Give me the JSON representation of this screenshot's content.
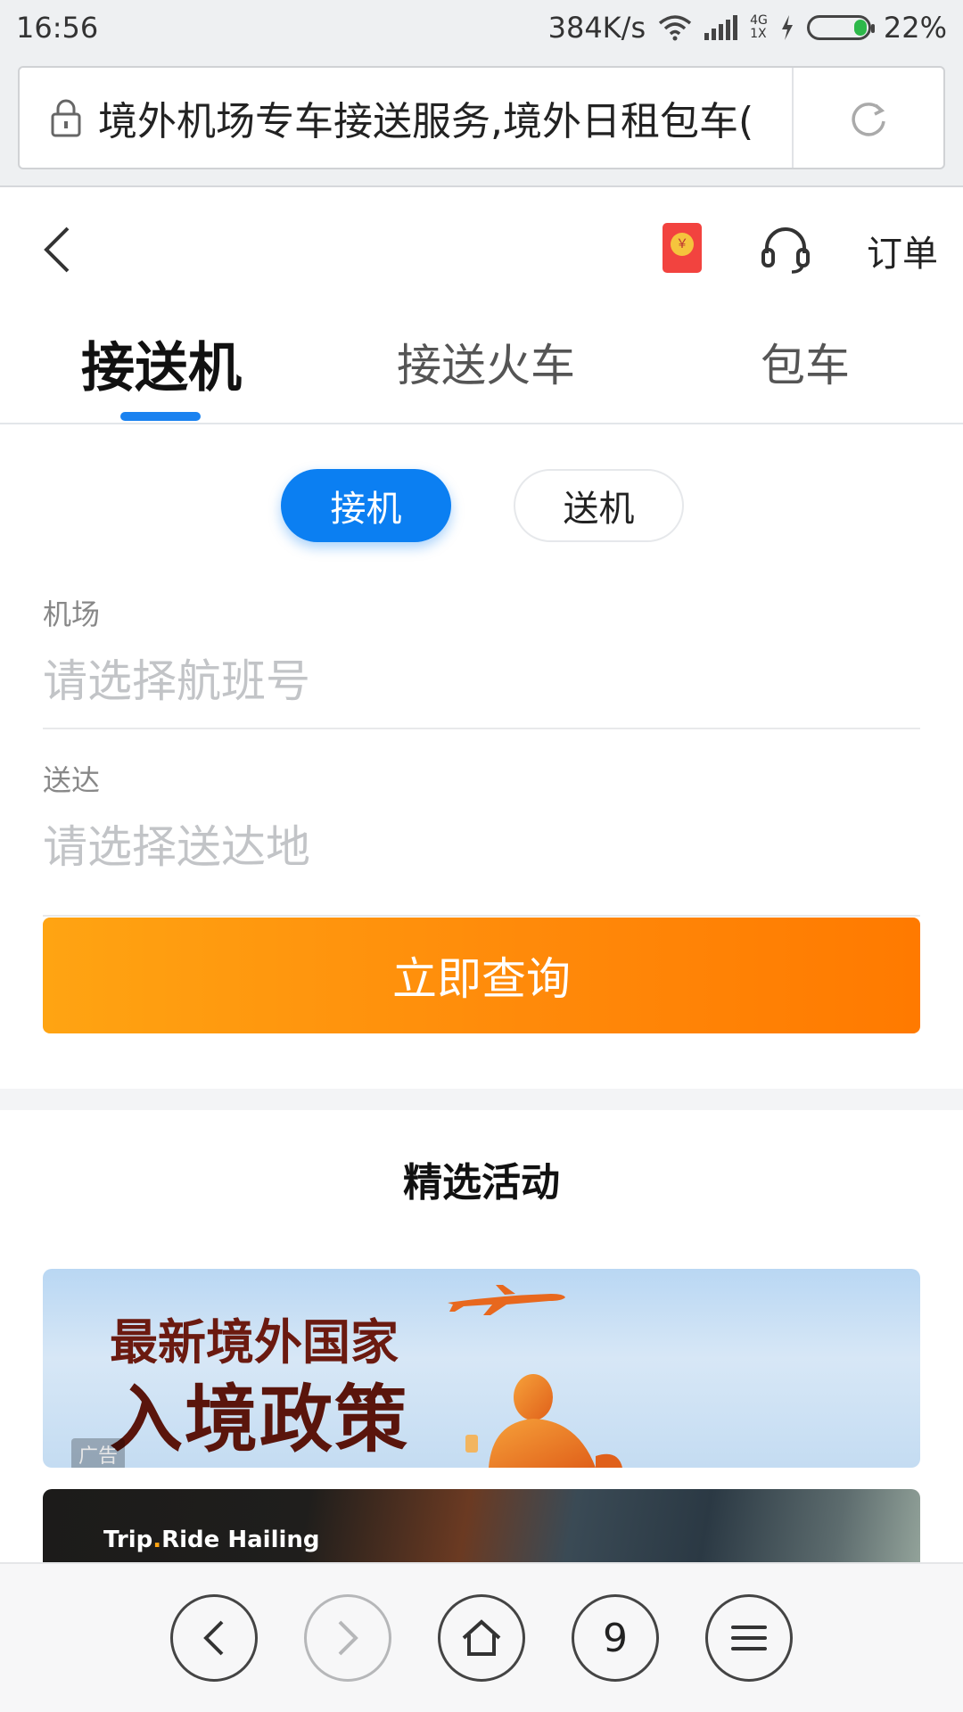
{
  "status_bar": {
    "time": "16:56",
    "net_speed": "384K/s",
    "net_type_top": "4G",
    "net_type_bottom": "1X",
    "battery": "22%",
    "battery_color": "#2db84a"
  },
  "browser": {
    "url_title": "境外机场专车接送服务,境外日租包车(",
    "lock_icon": "lock-icon",
    "reload_icon": "reload-icon"
  },
  "header": {
    "back_icon": "chevron-left-icon",
    "red_packet_icon": "red-packet-icon",
    "support_icon": "headset-icon",
    "orders_label": "订单"
  },
  "tabs": [
    {
      "label": "接送机",
      "active": true
    },
    {
      "label": "接送火车",
      "active": false
    },
    {
      "label": "包车",
      "active": false
    }
  ],
  "mode": {
    "pickup_label": "接机",
    "dropoff_label": "送机",
    "selected": "接机",
    "accent": "#0b7ff2"
  },
  "form": {
    "airport_label": "机场",
    "airport_placeholder": "请选择航班号",
    "destination_label": "送达",
    "destination_placeholder": "请选择送达地",
    "search_button": "立即查询",
    "button_color": "#ff8a0a"
  },
  "featured": {
    "title": "精选活动",
    "banners": [
      {
        "line1": "最新境外国家",
        "line2": "入境政策",
        "badge": "广告"
      },
      {
        "logo_prefix": "Trip",
        "logo_dot": ".",
        "logo_suffix": "Ride Hailing"
      }
    ]
  },
  "bottom_nav": {
    "back_icon": "chevron-left-icon",
    "forward_icon": "chevron-right-icon",
    "home_icon": "home-icon",
    "tab_count": "9",
    "menu_icon": "menu-icon"
  }
}
